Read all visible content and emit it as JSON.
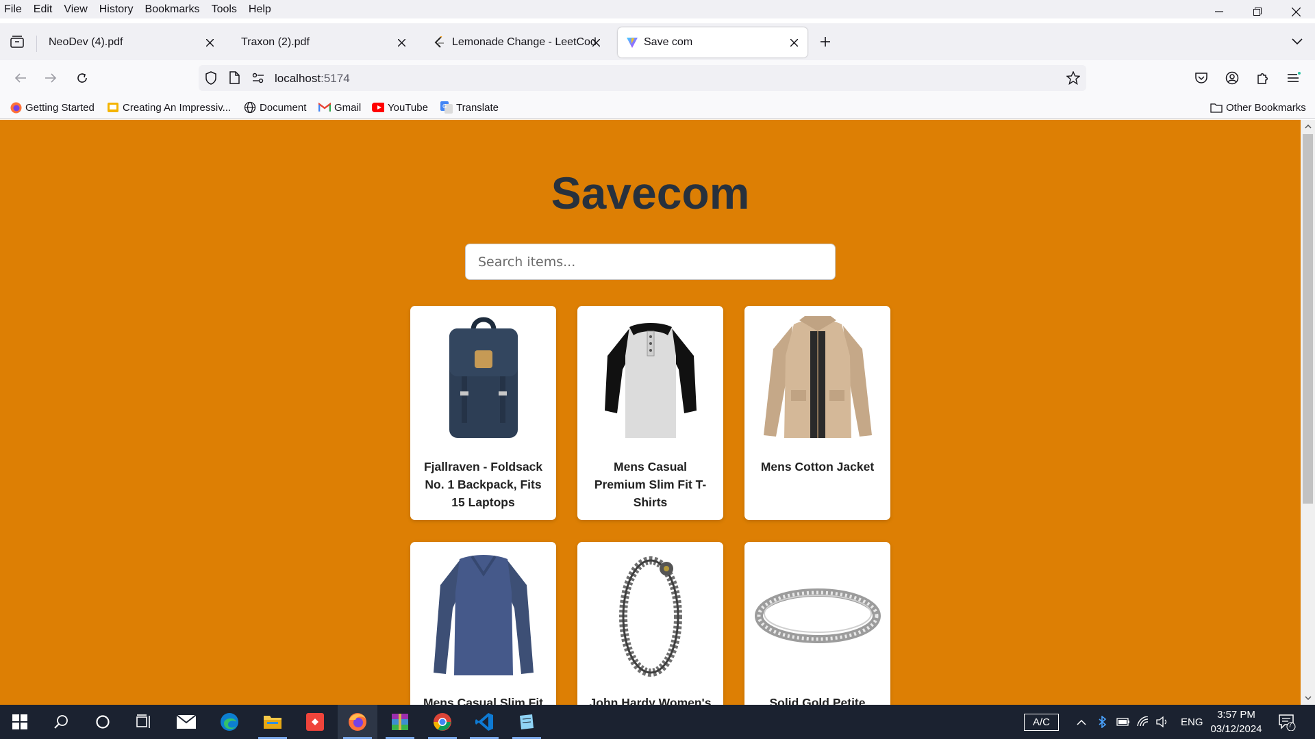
{
  "menubar": {
    "items": [
      "File",
      "Edit",
      "View",
      "History",
      "Bookmarks",
      "Tools",
      "Help"
    ]
  },
  "tabs": [
    {
      "title": "NeoDev (4).pdf"
    },
    {
      "title": "Traxon (2).pdf"
    },
    {
      "title": "Lemonade Change - LeetCode"
    },
    {
      "title": "Save com"
    }
  ],
  "url": {
    "host": "localhost",
    "port": ":5174"
  },
  "bookmarks": {
    "items": [
      "Getting Started",
      "Creating An Impressiv...",
      "Document",
      "Gmail",
      "YouTube",
      "Translate"
    ],
    "other": "Other Bookmarks"
  },
  "page": {
    "title": "Savecom",
    "search_placeholder": "Search items...",
    "products": [
      {
        "title": "Fjallraven - Foldsack No. 1 Backpack, Fits 15 Laptops"
      },
      {
        "title": "Mens Casual Premium Slim Fit T-Shirts"
      },
      {
        "title": "Mens Cotton Jacket"
      },
      {
        "title": "Mens Casual Slim Fit"
      },
      {
        "title": "John Hardy Women's"
      },
      {
        "title": "Solid Gold Petite"
      }
    ]
  },
  "taskbar": {
    "ac_label": "A/C",
    "lang": "ENG",
    "time": "3:57 PM",
    "date": "03/12/2024",
    "notification_count": "7"
  },
  "colors": {
    "page_bg": "#dd7f04",
    "title": "#27313d",
    "accent": "#0060df"
  }
}
